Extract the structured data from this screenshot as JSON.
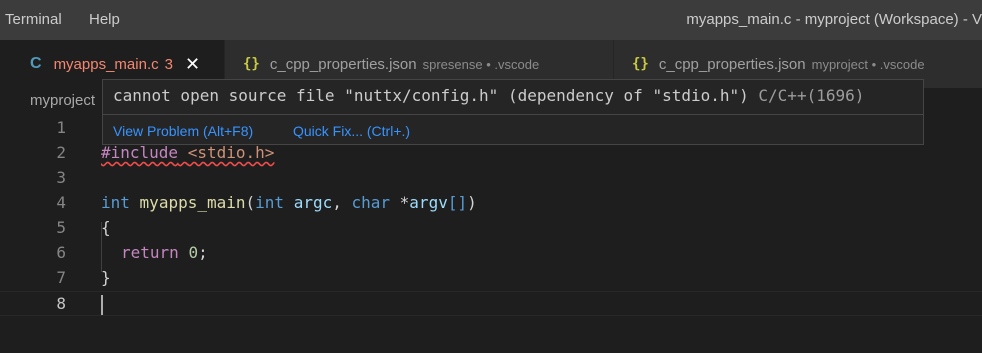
{
  "menu": [
    "Terminal",
    "Help"
  ],
  "window_title": "myapps_main.c - myproject (Workspace) - V",
  "tabs": [
    {
      "icon": "C",
      "label": "myapps_main.c",
      "problems": "3",
      "close": "✕",
      "active": true
    },
    {
      "icon": "{}",
      "label": "c_cpp_properties.json",
      "description": "spresense • .vscode"
    },
    {
      "icon": "{}",
      "label": "c_cpp_properties.json",
      "description": "myproject • .vscode"
    }
  ],
  "breadcrumb": "myproject",
  "editor": {
    "lines": [
      {
        "n": "1"
      },
      {
        "n": "2",
        "include_directive": "#include",
        "include_target": "<stdio.h>"
      },
      {
        "n": "3"
      },
      {
        "n": "4",
        "type1": "int",
        "func": "myapps_main",
        "type2": "int",
        "param1": "argc",
        "type3": "char",
        "param2": "argv"
      },
      {
        "n": "5",
        "text": "{"
      },
      {
        "n": "6",
        "keyword": "return",
        "value": "0"
      },
      {
        "n": "7",
        "text": "}"
      },
      {
        "n": "8"
      }
    ]
  },
  "hover": {
    "message": "cannot open source file \"nuttx/config.h\" (dependency of \"stdio.h\")",
    "source": "C/C++(1696)",
    "actions": {
      "view_problem": "View Problem (Alt+F8)",
      "quick_fix": "Quick Fix... (Ctrl+.)"
    }
  }
}
